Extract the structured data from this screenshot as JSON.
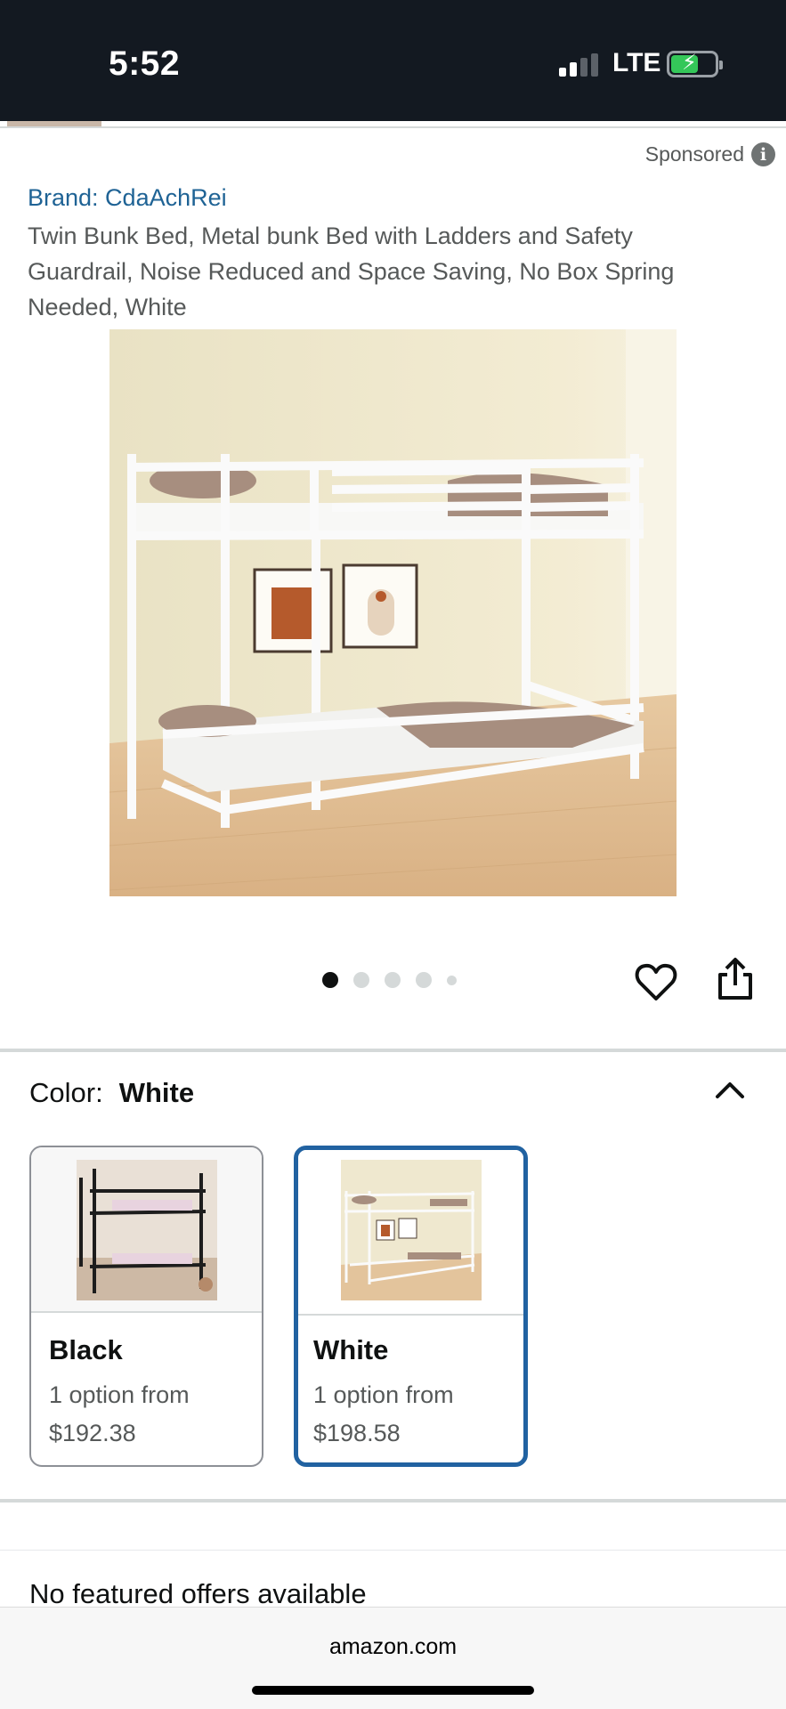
{
  "status_bar": {
    "time": "5:52",
    "network": "LTE"
  },
  "product": {
    "sponsored_label": "Sponsored",
    "brand": "Brand: CdaAchRei",
    "title": "Twin Bunk Bed, Metal bunk Bed with Ladders and Safety Guardrail, Noise Reduced and Space Saving, No Box Spring Needed, White",
    "image_count": 5,
    "active_image_index": 0
  },
  "color_selector": {
    "label": "Color:",
    "selected": "White",
    "options": [
      {
        "name": "Black",
        "line1": "1 option from",
        "price": "$192.38",
        "selected": false
      },
      {
        "name": "White",
        "line1": "1 option from",
        "price": "$198.58",
        "selected": true
      }
    ]
  },
  "offers": {
    "text": "No featured offers available"
  },
  "browser": {
    "url": "amazon.com"
  },
  "colors": {
    "brand_link": "#1f6395",
    "selected_border": "#2162a1",
    "status_bar_bg": "#131921"
  },
  "icons": [
    "info-icon",
    "heart-icon",
    "share-icon",
    "chevron-up-icon"
  ]
}
